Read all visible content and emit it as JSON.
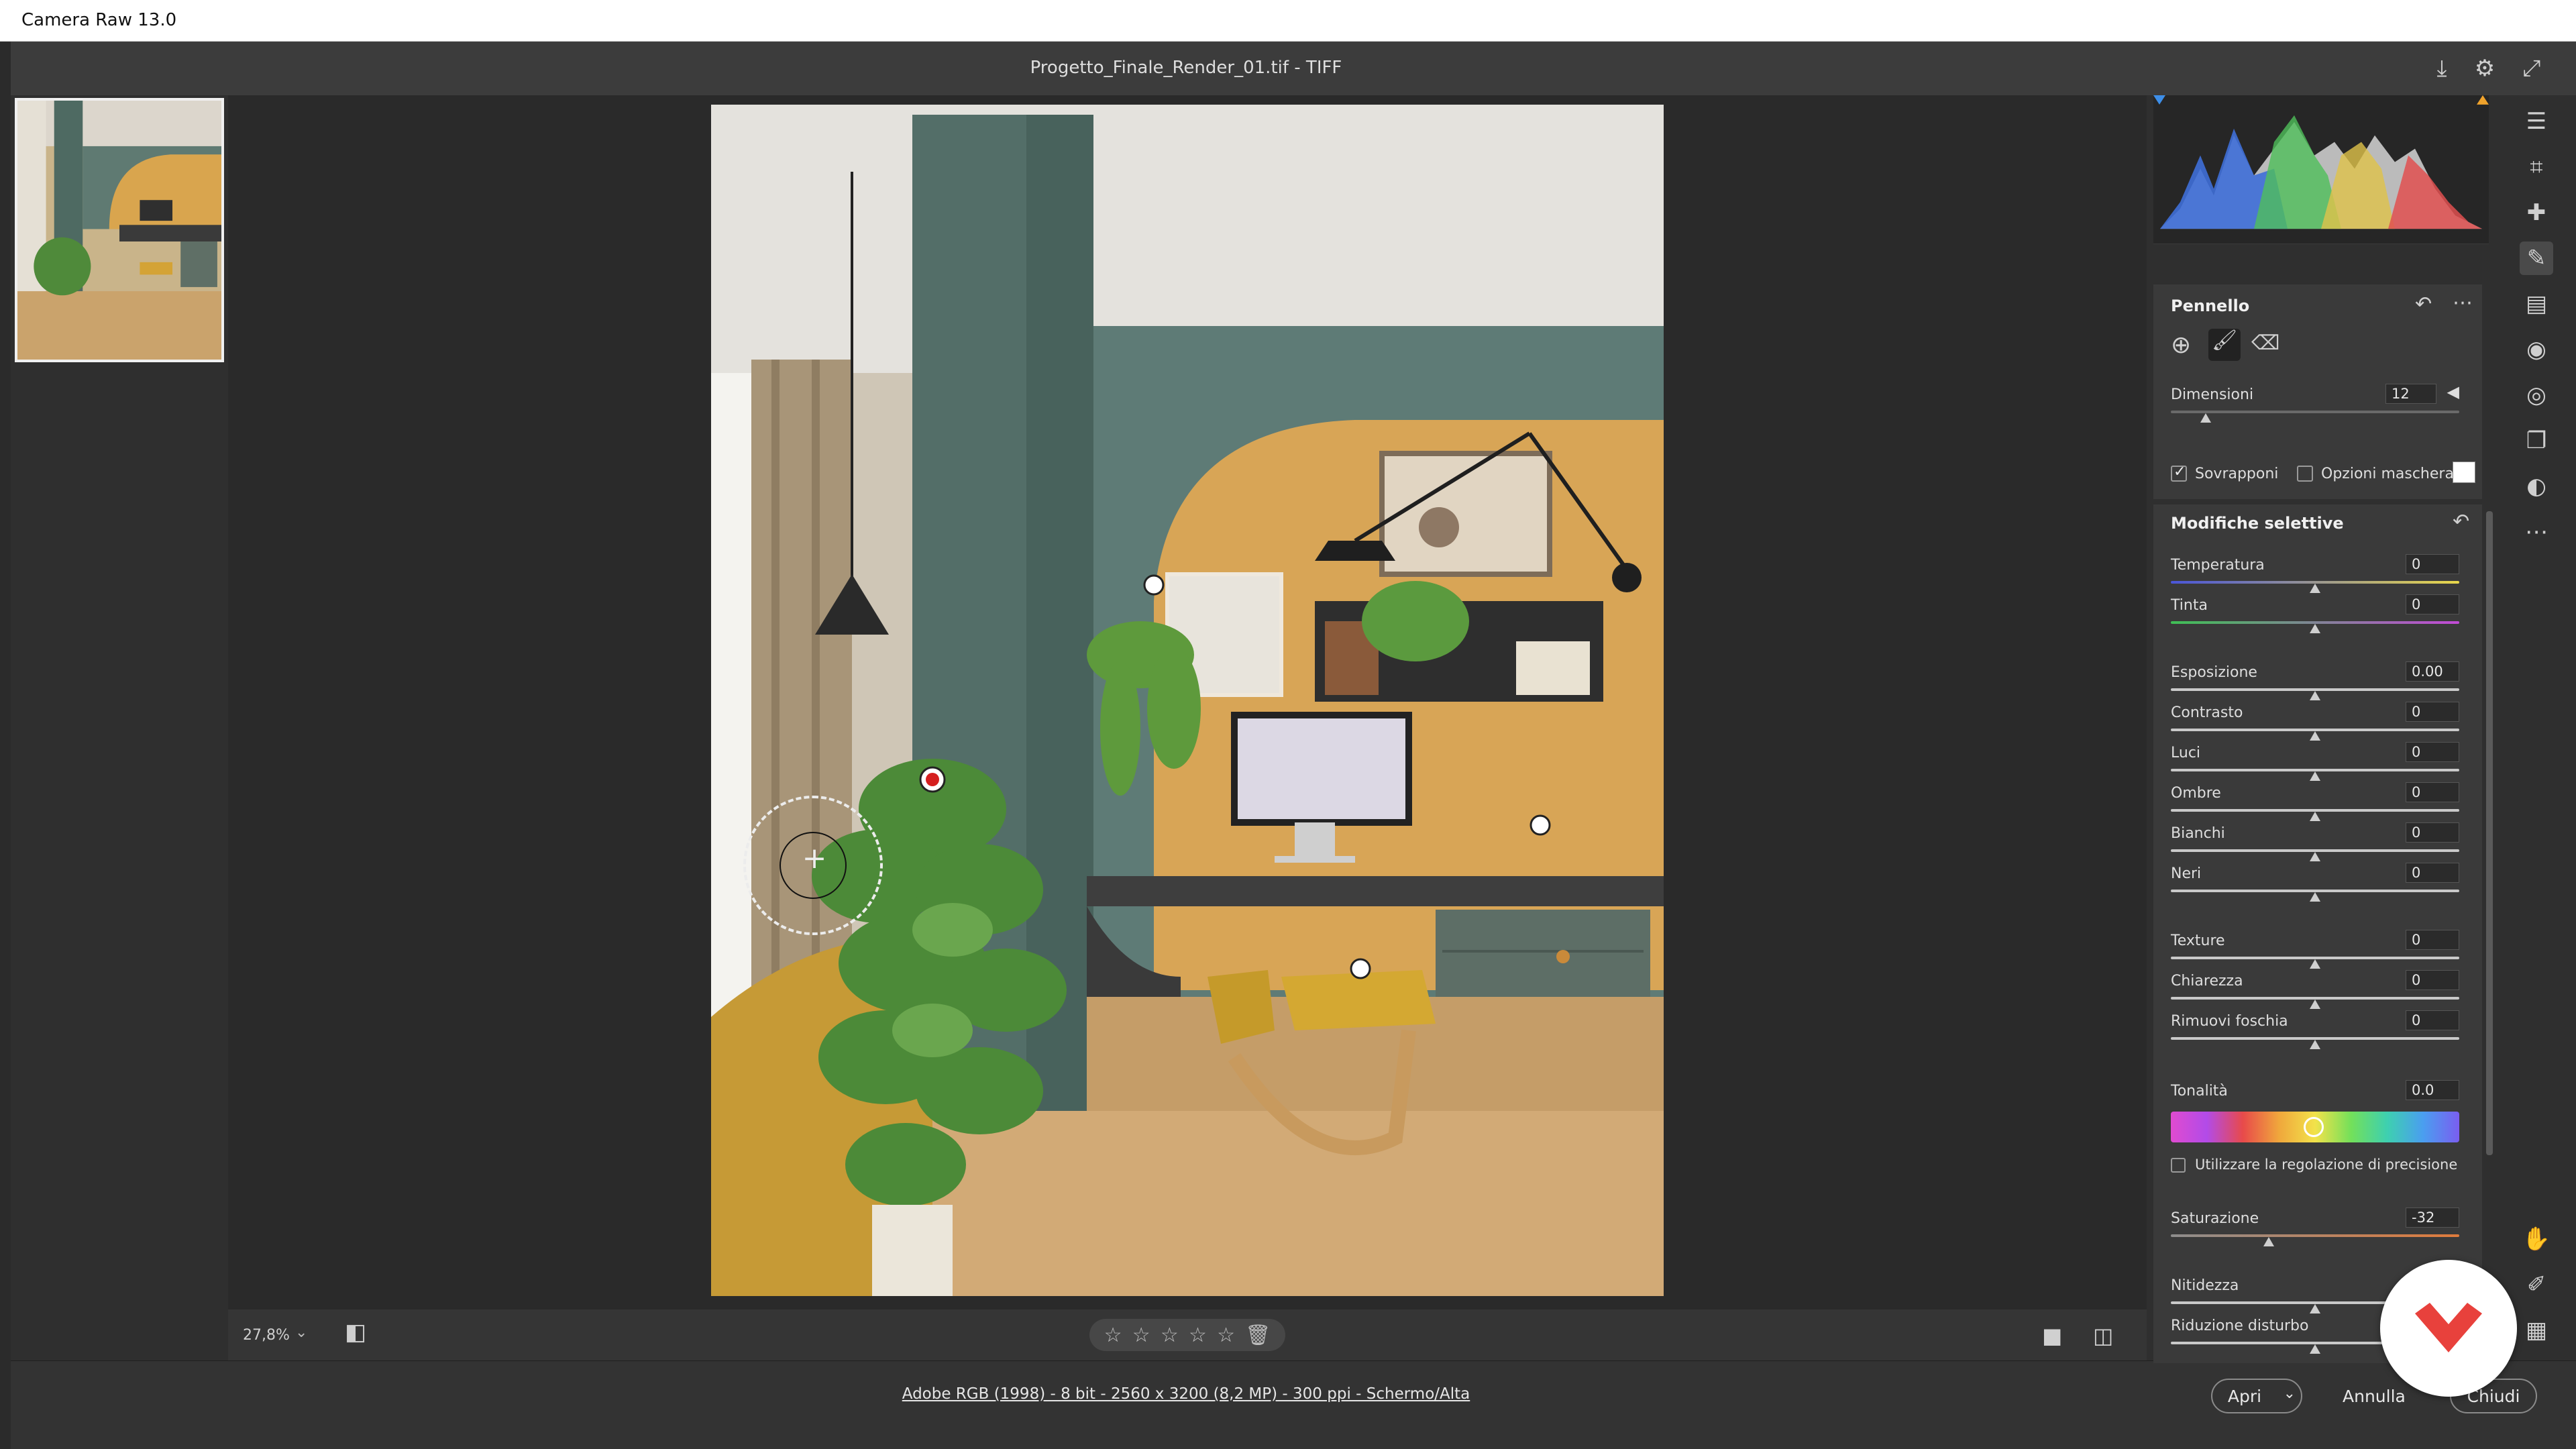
{
  "window": {
    "title": "Camera Raw 13.0"
  },
  "header": {
    "document": "Progetto_Finale_Render_01.tif  -  TIFF",
    "icons": [
      "save-icon",
      "gear-icon",
      "fullscreen-icon"
    ]
  },
  "canvas": {
    "zoom": "27,8%",
    "rating_stars": 5
  },
  "footer": {
    "info": "Adobe RGB (1998) - 8 bit - 2560 x 3200 (8,2 MP) - 300 ppi - Schermo/Alta",
    "open": "Apri",
    "cancel": "Annulla",
    "close": "Chiudi"
  },
  "brush_panel": {
    "title": "Pennello",
    "size_label": "Dimensioni",
    "size_value": "12",
    "overlay_label": "Sovrapponi",
    "overlay_checked": true,
    "mask_options_label": "Opzioni maschera",
    "mask_options_checked": false
  },
  "selective": {
    "title": "Modifiche selettive",
    "sliders": [
      {
        "label": "Temperatura",
        "value": "0",
        "pos": 0.5
      },
      {
        "label": "Tinta",
        "value": "0",
        "pos": 0.5
      },
      {
        "label": "Esposizione",
        "value": "0.00",
        "pos": 0.5
      },
      {
        "label": "Contrasto",
        "value": "0",
        "pos": 0.5
      },
      {
        "label": "Luci",
        "value": "0",
        "pos": 0.5
      },
      {
        "label": "Ombre",
        "value": "0",
        "pos": 0.5
      },
      {
        "label": "Bianchi",
        "value": "0",
        "pos": 0.5
      },
      {
        "label": "Neri",
        "value": "0",
        "pos": 0.5
      },
      {
        "label": "Texture",
        "value": "0",
        "pos": 0.5
      },
      {
        "label": "Chiarezza",
        "value": "0",
        "pos": 0.5
      },
      {
        "label": "Rimuovi foschia",
        "value": "0",
        "pos": 0.5
      },
      {
        "label": "Saturazione",
        "value": "-32",
        "pos": 0.34
      },
      {
        "label": "Nitidezza",
        "value": "",
        "pos": 0.5
      },
      {
        "label": "Riduzione disturbo",
        "value": "",
        "pos": 0.5
      }
    ],
    "hue_label": "Tonalità",
    "hue_value": "0.0",
    "fine_tune_label": "Utilizzare la regolazione di precisione",
    "fine_tune_checked": false
  },
  "colors": {
    "accent": "#e8413c",
    "panel": "#3a3a3a",
    "background": "#2b2b2b"
  }
}
